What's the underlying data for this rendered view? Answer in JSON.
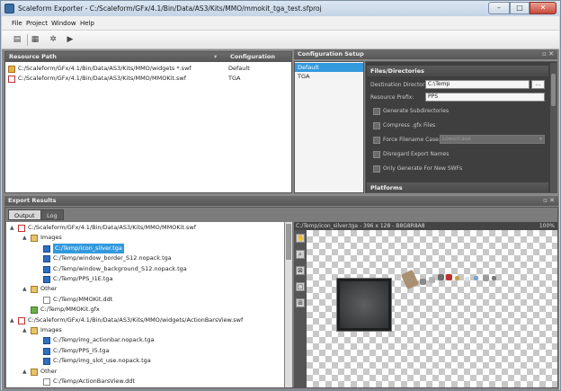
{
  "window": {
    "title": "Scaleform Exporter - C:/Scaleform/GFx/4.1/Bin/Data/AS3/Kits/MMO/mmokit_tga_test.sfproj"
  },
  "menu": [
    "File",
    "Project",
    "Window",
    "Help"
  ],
  "resources": {
    "col_path": "Resource Path",
    "col_config": "Configuration",
    "rows": [
      {
        "path": "C:/Scaleform/GFx/4.1/Bin/Data/AS3/Kits/MMO/widgets *.swf",
        "config": "Default"
      },
      {
        "path": "C:/Scaleform/GFx/4.1/Bin/Data/AS3/Kits/MMO/MMOKit.swf",
        "config": "TGA"
      }
    ]
  },
  "config_setup": {
    "title": "Configuration Setup",
    "items": [
      "Default",
      "TGA"
    ]
  },
  "properties": {
    "section_files": "Files/Directories",
    "dest_label": "Destination Directory:",
    "dest_value": "C:\\Temp",
    "browse_label": "...",
    "prefix_label": "Resource Prefix:",
    "prefix_value": "PPS",
    "options": [
      "Generate Subdirectories",
      "Compress .gfx Files",
      "Force Filename Case:",
      "Disregard Export Names",
      "Only Generate For New SWFs"
    ],
    "case_value": "Lowercase",
    "section_platforms": "Platforms"
  },
  "export": {
    "title": "Export Results",
    "tabs": [
      "Output",
      "Log"
    ],
    "tree": [
      {
        "label": "C:/Scaleform/GFx/4.1/Bin/Data/AS3/Kits/MMO/MMOKit.swf",
        "level": 0,
        "kind": "swf",
        "exp": "▲"
      },
      {
        "label": "Images",
        "level": 1,
        "kind": "folder",
        "exp": "▲"
      },
      {
        "label": "C:/Temp/icon_silver.tga",
        "level": 2,
        "kind": "tga",
        "sel": true
      },
      {
        "label": "C:/Temp/window_border_S12.nopack.tga",
        "level": 2,
        "kind": "tga"
      },
      {
        "label": "C:/Temp/window_background_S12.nopack.tga",
        "level": 2,
        "kind": "tga"
      },
      {
        "label": "C:/Temp/PPS_I1E.tga",
        "level": 2,
        "kind": "tga"
      },
      {
        "label": "Other",
        "level": 1,
        "kind": "folder",
        "exp": "▲"
      },
      {
        "label": "C:/Temp/MMOKit.ddt",
        "level": 2,
        "kind": "file"
      },
      {
        "label": "C:/Temp/MMOKit.gfx",
        "level": 1,
        "kind": "gfx"
      },
      {
        "label": "C:/Scaleform/GFx/4.1/Bin/Data/AS3/Kits/MMO/widgets/ActionBarsView.swf",
        "level": 0,
        "kind": "swf",
        "exp": "▲"
      },
      {
        "label": "Images",
        "level": 1,
        "kind": "folder",
        "exp": "▲"
      },
      {
        "label": "C:/Temp/img_actionbar.nopack.tga",
        "level": 2,
        "kind": "tga"
      },
      {
        "label": "C:/Temp/PPS_I5.tga",
        "level": 2,
        "kind": "tga"
      },
      {
        "label": "C:/Temp/img_slot_use.nopack.tga",
        "level": 2,
        "kind": "tga"
      },
      {
        "label": "Other",
        "level": 1,
        "kind": "folder",
        "exp": "▲"
      },
      {
        "label": "C:/Temp/ActionBarsView.ddt",
        "level": 2,
        "kind": "file"
      }
    ],
    "preview_info": "C:/Temp/icon_silver.tga - 396 x 128 - B8G8R8A8",
    "zoom": "100%"
  }
}
